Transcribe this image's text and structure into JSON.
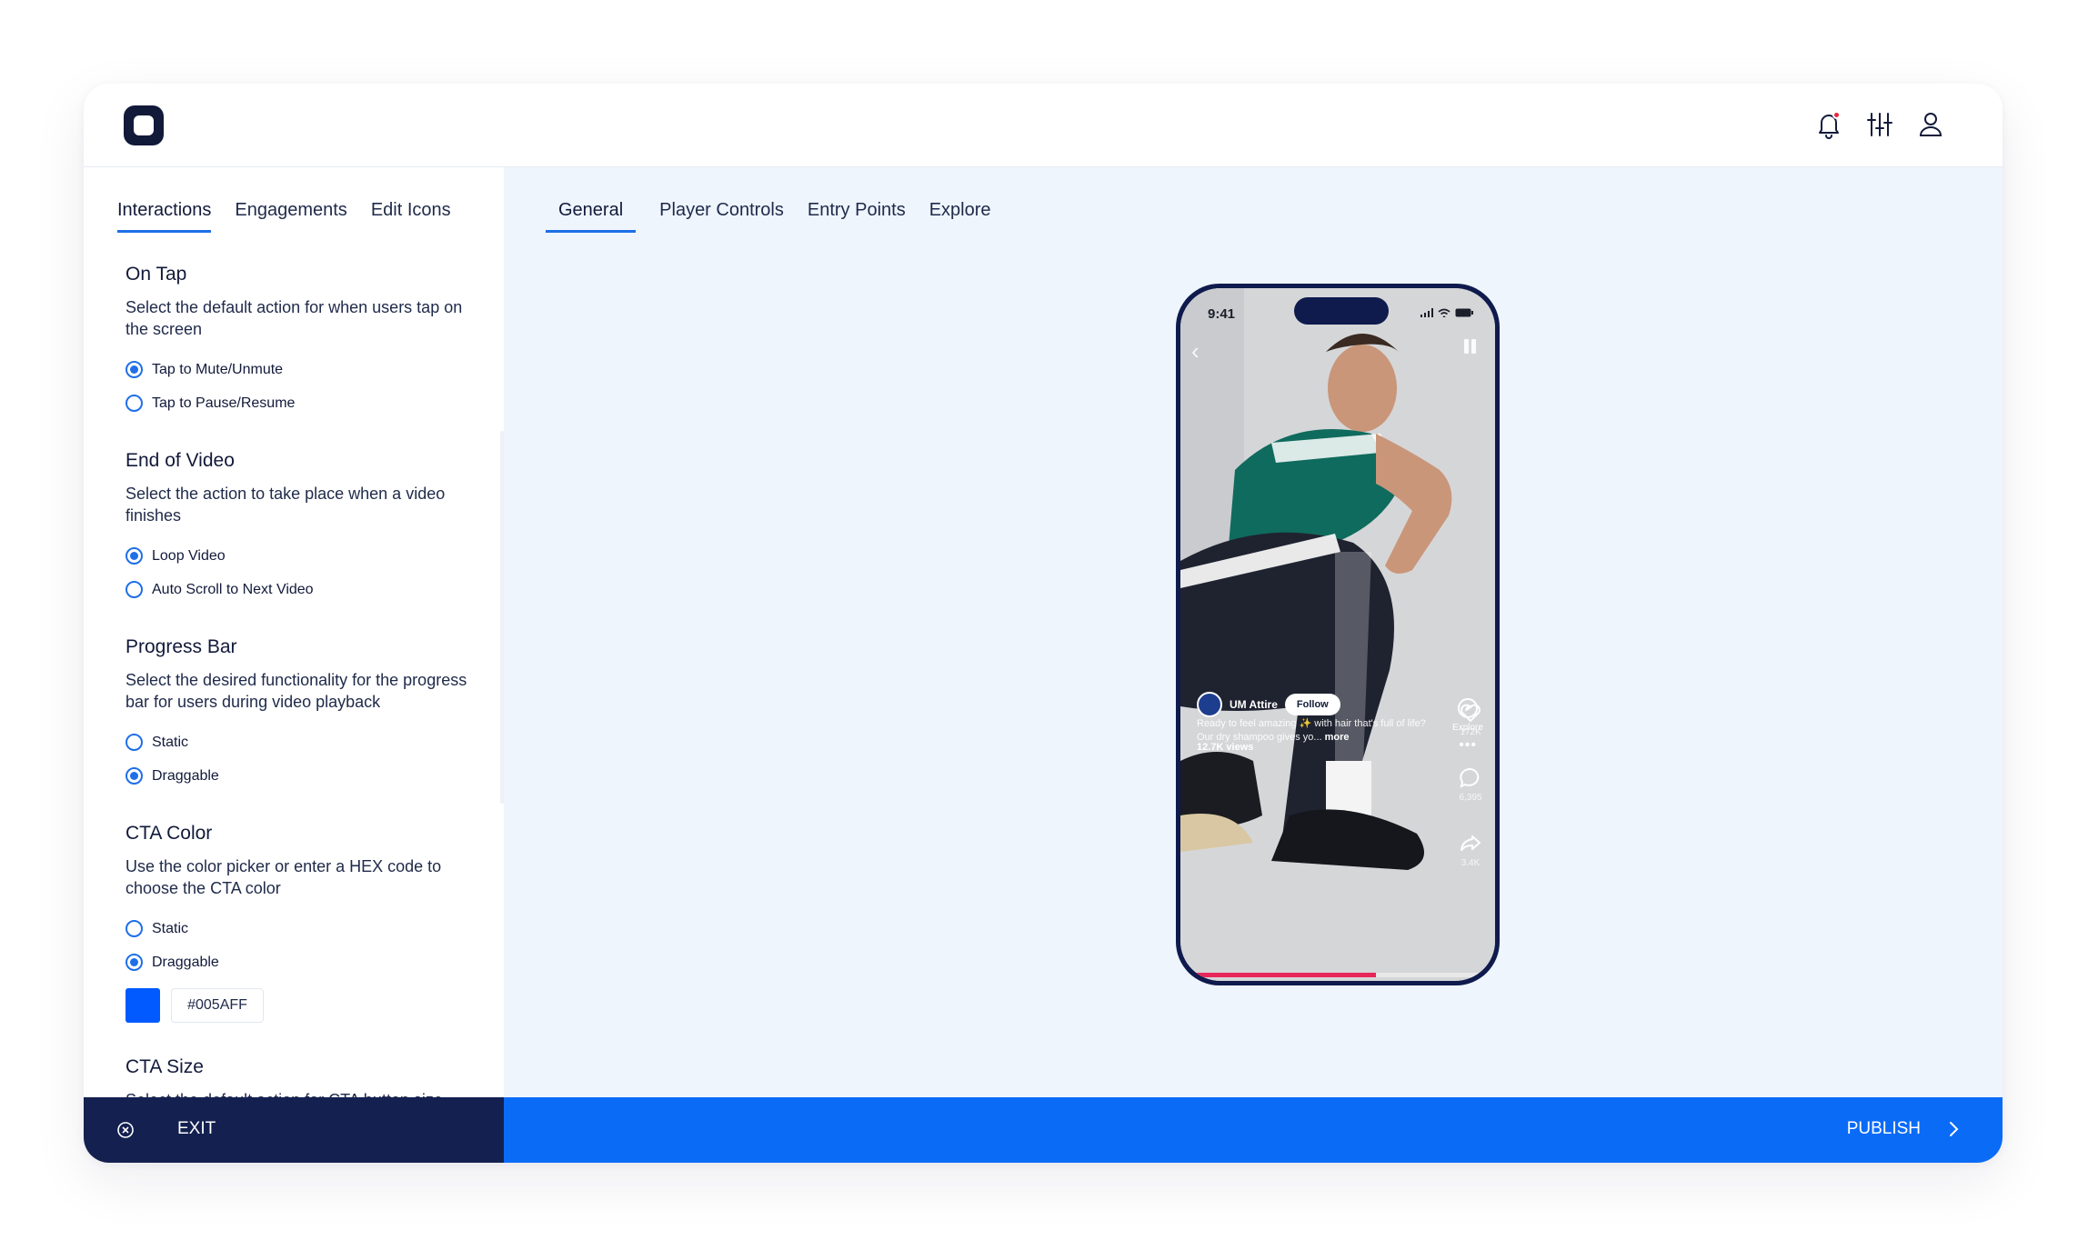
{
  "header": {
    "icons": [
      "logo",
      "bell-icon",
      "sliders-icon",
      "user-icon"
    ],
    "notification_color": "#E8263D"
  },
  "sidebar": {
    "tabs": [
      {
        "label": "Interactions",
        "active": true
      },
      {
        "label": "Engagements",
        "active": false
      },
      {
        "label": "Edit Icons",
        "active": false
      }
    ],
    "sections": [
      {
        "title": "On Tap",
        "description": "Select the default action for when users tap on the screen",
        "options": [
          {
            "label": "Tap to Mute/Unmute",
            "selected": true
          },
          {
            "label": "Tap to Pause/Resume",
            "selected": false
          }
        ]
      },
      {
        "title": "End of Video",
        "description": "Select the action to take place when a video finishes",
        "options": [
          {
            "label": "Loop Video",
            "selected": true
          },
          {
            "label": "Auto Scroll to Next Video",
            "selected": false
          }
        ]
      },
      {
        "title": "Progress Bar",
        "description": "Select the desired functionality for the progress bar for users during video playback",
        "options": [
          {
            "label": "Static",
            "selected": false
          },
          {
            "label": "Draggable",
            "selected": true
          }
        ]
      },
      {
        "title": "CTA Color",
        "description": "Use the color picker or enter a HEX code to choose the CTA color",
        "options": [
          {
            "label": "Static",
            "selected": false
          },
          {
            "label": "Draggable",
            "selected": true
          }
        ],
        "color_value": "#005AFF"
      },
      {
        "title": "CTA Size",
        "description": "Select the default action for CTA button size"
      }
    ]
  },
  "main": {
    "tabs": [
      {
        "label": "General",
        "active": true
      },
      {
        "label": "Player Controls",
        "active": false
      },
      {
        "label": "Entry Points",
        "active": false
      },
      {
        "label": "Explore",
        "active": false
      }
    ],
    "preview": {
      "time": "9:41",
      "creator": "UM Attire",
      "follow_label": "Follow",
      "caption": "Ready to feel amazing ✨ with hair that's full of life? Our dry shampoo gives yo...",
      "more_label": "more",
      "views": "12.7K views",
      "likes": "172K",
      "comments": "6,395",
      "shares": "3.4K",
      "explore_label": "Explore",
      "progress": 0.62,
      "progress_color": "#E8265A"
    }
  },
  "footer": {
    "exit_label": "EXIT",
    "publish_label": "PUBLISH",
    "exit_bg": "#142050",
    "publish_bg": "#0A6BF7"
  }
}
